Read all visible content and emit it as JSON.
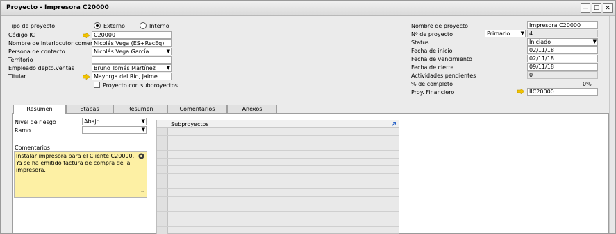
{
  "window": {
    "title": "Proyecto - Impresora C20000",
    "min": "—",
    "max": "☐",
    "close": "✕"
  },
  "left": {
    "tipo_label": "Tipo de proyecto",
    "radio_externo": "Externo",
    "radio_interno": "Interno",
    "codigo_label": "Código IC",
    "codigo_value": "C20000",
    "nombre_interlocutor_label": "Nombre de interlocutor comercial",
    "nombre_interlocutor_value": "Nicolás Vega (ES+RecEq)",
    "persona_label": "Persona de contacto",
    "persona_value": "Nicolás Vega García",
    "territorio_label": "Territorio",
    "territorio_value": "",
    "empleado_label": "Empleado depto.ventas",
    "empleado_value": "Bruno Tomás Martínez",
    "titular_label": "Titular",
    "titular_value": "Mayorga del Río, Jaime",
    "subproyectos_label": "Proyecto con subproyectos"
  },
  "right": {
    "nombre_proyecto_label": "Nombre de proyecto",
    "nombre_proyecto_value": "Impresora C20000",
    "num_proyecto_label": "Nº de proyecto",
    "num_series": "Primario",
    "num_value": "4",
    "status_label": "Status",
    "status_value": "Iniciado",
    "inicio_label": "Fecha de inicio",
    "inicio_value": "02/11/18",
    "vencimiento_label": "Fecha de vencimiento",
    "vencimiento_value": "02/11/18",
    "cierre_label": "Fecha de cierre",
    "cierre_value": "09/11/18",
    "actividades_label": "Actividades pendientes",
    "actividades_value": "0",
    "completo_label": "% de completo",
    "completo_value": "0%",
    "financiero_label": "Proy. Financiero",
    "financiero_value": "IIC20000"
  },
  "tabs": [
    "Resumen",
    "Etapas",
    "Resumen",
    "Comentarios",
    "Anexos"
  ],
  "panel": {
    "riesgo_label": "Nivel de riesgo",
    "riesgo_value": "Abajo",
    "ramo_label": "Ramo",
    "ramo_value": "",
    "comentarios_label": "Comentarios",
    "comentarios_text": "Instalar impresora para el Cliente C20000. Ya se ha emitido factura de compra de la impresora.",
    "subproyectos_header": "Subproyectos"
  },
  "colors": {
    "comment_bg": "#fdf0a4",
    "link_arrow": "#f2c400"
  }
}
